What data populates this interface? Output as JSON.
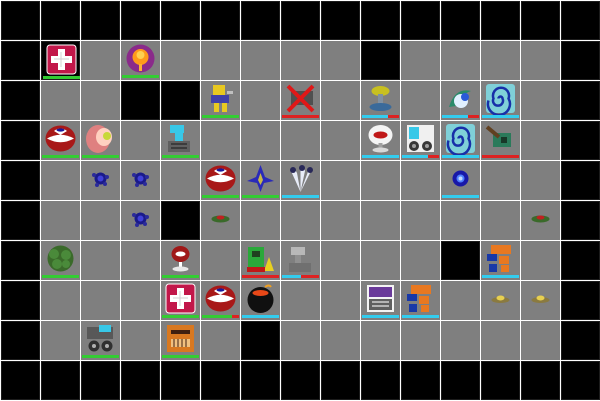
{
  "grid": {
    "cols": 15,
    "rows": 10
  },
  "colors": {
    "floor": "#7f7f7f",
    "wall": "#000000",
    "grid_line": "#ffffff",
    "health_green": "#33cc33",
    "mana_cyan": "#33ccee",
    "damage_red": "#dd2222"
  },
  "wall_openings": [
    [
      1,
      1
    ],
    [
      3,
      2
    ],
    [
      4,
      2
    ],
    [
      9,
      1
    ],
    [
      4,
      5
    ],
    [
      11,
      6
    ],
    [
      6,
      8
    ]
  ],
  "units": [
    {
      "name": "white-cross-red-tile-icon",
      "col": 1,
      "row": 1,
      "bar": {
        "color": "#33cc33",
        "level": 1.0
      }
    },
    {
      "name": "orange-flame-orb-icon",
      "col": 3,
      "row": 1,
      "bar": {
        "color": "#33cc33",
        "level": 1.0
      }
    },
    {
      "name": "yellow-blue-mech-icon",
      "col": 5,
      "row": 2,
      "bar": {
        "color": "#33cc33",
        "level": 1.0
      }
    },
    {
      "name": "red-x-crossed-unit-icon",
      "col": 7,
      "row": 2,
      "bar": {
        "color": "#dd2222",
        "level": 1.0
      }
    },
    {
      "name": "yellow-satellite-dish-icon",
      "col": 9,
      "row": 2,
      "bar": {
        "color": "#33ccee",
        "level": 0.7
      }
    },
    {
      "name": "green-blue-swirl-icon",
      "col": 11,
      "row": 2,
      "bar": {
        "color": "#33ccee",
        "level": 0.7
      }
    },
    {
      "name": "blue-spiral-tile-icon",
      "col": 12,
      "row": 2,
      "bar": {
        "color": "#33ccee",
        "level": 1.0
      }
    },
    {
      "name": "red-white-pod-icon",
      "col": 1,
      "row": 3,
      "bar": {
        "color": "#33cc33",
        "level": 1.0
      }
    },
    {
      "name": "pink-blob-creature-icon",
      "col": 2,
      "row": 3,
      "bar": {
        "color": "#33cc33",
        "level": 1.0
      }
    },
    {
      "name": "cyan-robot-icon",
      "col": 4,
      "row": 3,
      "bar": {
        "color": "#33cc33",
        "level": 1.0
      }
    },
    {
      "name": "white-red-mushroom-icon",
      "col": 9,
      "row": 3,
      "bar": {
        "color": "#33ccee",
        "level": 1.0
      }
    },
    {
      "name": "cyan-gear-tank-icon",
      "col": 10,
      "row": 3,
      "bar": {
        "color": "#33ccee",
        "level": 0.7
      }
    },
    {
      "name": "blue-spiral-tile-icon",
      "col": 11,
      "row": 3,
      "bar": {
        "color": "#33ccee",
        "level": 1.0
      }
    },
    {
      "name": "green-cannon-tile-icon",
      "col": 12,
      "row": 3,
      "bar": {
        "color": "#dd2222",
        "level": 1.0
      }
    },
    {
      "name": "blue-spore-cluster-icon",
      "col": 2,
      "row": 4,
      "bar": null
    },
    {
      "name": "blue-spore-cluster-icon",
      "col": 3,
      "row": 4,
      "bar": null
    },
    {
      "name": "red-white-pod-icon",
      "col": 5,
      "row": 4,
      "bar": {
        "color": "#33cc33",
        "level": 1.0
      }
    },
    {
      "name": "blue-star-drone-icon",
      "col": 6,
      "row": 4,
      "bar": {
        "color": "#33cc33",
        "level": 1.0
      }
    },
    {
      "name": "white-feather-plume-icon",
      "col": 7,
      "row": 4,
      "bar": {
        "color": "#33ccee",
        "level": 1.0
      }
    },
    {
      "name": "blue-energy-orb-icon",
      "col": 11,
      "row": 4,
      "bar": {
        "color": "#33ccee",
        "level": 1.0
      }
    },
    {
      "name": "blue-spore-cluster-icon",
      "col": 3,
      "row": 5,
      "bar": null
    },
    {
      "name": "green-red-landmine-icon",
      "col": 5,
      "row": 5,
      "bar": null
    },
    {
      "name": "green-red-landmine-icon",
      "col": 13,
      "row": 5,
      "bar": null
    },
    {
      "name": "green-moss-plant-icon",
      "col": 1,
      "row": 6,
      "bar": {
        "color": "#33cc33",
        "level": 1.0
      }
    },
    {
      "name": "red-sprout-pod-icon",
      "col": 4,
      "row": 6,
      "bar": {
        "color": "#33cc33",
        "level": 1.0
      }
    },
    {
      "name": "green-yellow-bulldozer-icon",
      "col": 6,
      "row": 6,
      "bar": {
        "color": "#dd2222",
        "level": 1.0
      }
    },
    {
      "name": "grey-turret-icon",
      "col": 7,
      "row": 6,
      "bar": {
        "color": "#33ccee",
        "level": 0.5
      }
    },
    {
      "name": "orange-blue-walker-icon",
      "col": 12,
      "row": 6,
      "bar": {
        "color": "#33ccee",
        "level": 1.0
      }
    },
    {
      "name": "white-cross-red-tile-icon",
      "col": 4,
      "row": 7,
      "bar": {
        "color": "#33cc33",
        "level": 1.0
      }
    },
    {
      "name": "red-white-pod-icon",
      "col": 5,
      "row": 7,
      "bar": {
        "color": "#33cc33",
        "level": 0.8
      }
    },
    {
      "name": "black-cauldron-bomb-icon",
      "col": 6,
      "row": 7,
      "bar": {
        "color": "#33ccee",
        "level": 1.0
      }
    },
    {
      "name": "purple-grey-generator-icon",
      "col": 9,
      "row": 7,
      "bar": {
        "color": "#33ccee",
        "level": 1.0
      }
    },
    {
      "name": "orange-blue-walker-icon",
      "col": 10,
      "row": 7,
      "bar": {
        "color": "#33ccee",
        "level": 1.0
      }
    },
    {
      "name": "yellow-saucer-mine-icon",
      "col": 12,
      "row": 7,
      "bar": null
    },
    {
      "name": "yellow-saucer-mine-icon",
      "col": 13,
      "row": 7,
      "bar": null
    },
    {
      "name": "grey-gear-tank-icon",
      "col": 2,
      "row": 8,
      "bar": {
        "color": "#33cc33",
        "level": 1.0
      }
    },
    {
      "name": "orange-crate-face-icon",
      "col": 4,
      "row": 8,
      "bar": {
        "color": "#33cc33",
        "level": 1.0
      }
    }
  ]
}
